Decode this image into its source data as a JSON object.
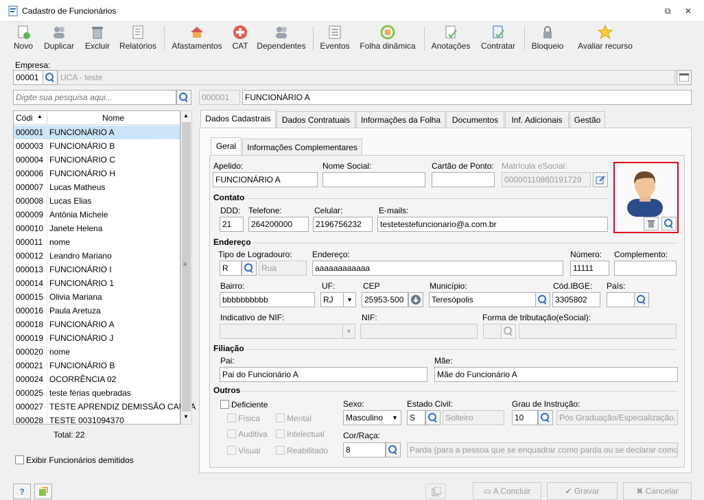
{
  "window": {
    "title": "Cadastro de Funcionários"
  },
  "toolbar": [
    {
      "label": "Novo",
      "icon": "new-doc-icon"
    },
    {
      "label": "Duplicar",
      "icon": "people-icon"
    },
    {
      "label": "Excluir",
      "icon": "trash-icon"
    },
    {
      "label": "Relatórios",
      "icon": "report-icon"
    },
    {
      "label": "Afastamentos",
      "icon": "house-icon"
    },
    {
      "label": "CAT",
      "icon": "medical-cross-icon"
    },
    {
      "label": "Dependentes",
      "icon": "people-icon"
    },
    {
      "label": "Eventos",
      "icon": "list-icon"
    },
    {
      "label": "Folha dinâmica",
      "icon": "calendar-refresh-icon"
    },
    {
      "label": "Anotações",
      "icon": "notes-icon"
    },
    {
      "label": "Contratar",
      "icon": "contract-icon"
    },
    {
      "label": "Bloqueio",
      "icon": "lock-icon"
    },
    {
      "label": "Avaliar recurso",
      "icon": "star-icon"
    }
  ],
  "company": {
    "label": "Empresa:",
    "code": "00001",
    "name": "UCA - teste"
  },
  "search": {
    "placeholder": "Digite sua pesquisa aqui..."
  },
  "selected": {
    "code": "000001",
    "name": "FUNCIONÁRIO A"
  },
  "list": {
    "headers": [
      "Códi",
      "Nome"
    ],
    "rows": [
      [
        "000001",
        "FUNCIONÁRIO A"
      ],
      [
        "000003",
        "FUNCIONÁRIO B"
      ],
      [
        "000004",
        "FUNCIONÁRIO C"
      ],
      [
        "000006",
        "FUNCIONÁRIO H"
      ],
      [
        "000007",
        "Lucas Matheus"
      ],
      [
        "000008",
        "Lucas Elias"
      ],
      [
        "000009",
        "Antônia Michele"
      ],
      [
        "000010",
        "Janete Helena"
      ],
      [
        "000011",
        "nome"
      ],
      [
        "000012",
        "Leandro Mariano"
      ],
      [
        "000013",
        "FUNCIONÁRIO I"
      ],
      [
        "000014",
        "FUNCIONÁRIO 1"
      ],
      [
        "000015",
        "Olivia Mariana"
      ],
      [
        "000016",
        "Paula Aretuza"
      ],
      [
        "000018",
        "FUNCIONÁRIO A"
      ],
      [
        "000019",
        "FUNCIONÁRIO J"
      ],
      [
        "000020",
        "nome"
      ],
      [
        "000021",
        "FUNCIONÁRIO B"
      ],
      [
        "000024",
        "OCORRÊNCIA 02"
      ],
      [
        "000025",
        "teste férias quebradas"
      ],
      [
        "000027",
        "TESTE APRENDIZ DEMISSÃO CAUSA"
      ],
      [
        "000028",
        "TESTE 0031094370"
      ]
    ],
    "total": "Total: 22"
  },
  "show_dismissed": "Exibir Funcionários demitidos",
  "tabs": [
    "Dados Cadastrais",
    "Dados Contratuais",
    "Informações da Folha",
    "Documentos",
    "Inf. Adicionais",
    "Gestão"
  ],
  "subtabs": [
    "Geral",
    "Informações Complementares"
  ],
  "form": {
    "apelido_label": "Apelido:",
    "apelido": "FUNCIONÁRIO A",
    "nome_social_label": "Nome Social:",
    "nome_social": "",
    "cartao_label": "Cartão de Ponto:",
    "cartao": "",
    "matricula_label": "Matrícula eSocial:",
    "matricula": "00000110860191729",
    "contato": "Contato",
    "ddd_label": "DDD:",
    "ddd": "21",
    "telefone_label": "Telefone:",
    "telefone": "264200000",
    "celular_label": "Celular:",
    "celular": "2196756232",
    "emails_label": "E-mails:",
    "emails": "testetestefuncionario@a.com.br",
    "endereco_sec": "Endereço",
    "tipo_label": "Tipo de Logradouro:",
    "tipo": "R",
    "tipo_desc": "Rua",
    "endereco_label": "Endereço:",
    "endereco": "aaaaaaaaaaaa",
    "numero_label": "Número:",
    "numero": "11111",
    "complemento_label": "Complemento:",
    "complemento": "",
    "bairro_label": "Bairro:",
    "bairro": "bbbbbbbbbb",
    "uf_label": "UF:",
    "uf": "RJ",
    "cep_label": "CEP",
    "cep": "25953-500",
    "municipio_label": "Município:",
    "municipio": "Teresópolis",
    "ibge_label": "Cód.IBGE:",
    "ibge": "3305802",
    "pais_label": "País:",
    "pais": "",
    "nif_ind_label": "Indicativo de NIF:",
    "nif_label": "NIF:",
    "trib_label": "Forma de tributação(eSocial):",
    "filiacao": "Filiação",
    "pai_label": "Pai:",
    "pai": "Pai do Funcionário A",
    "mae_label": "Mãe:",
    "mae": "Mãe do Funcionário A",
    "outros": "Outros",
    "deficiente": "Deficiente",
    "def_opts": [
      "Física",
      "Mental",
      "Auditiva",
      "Intelectual",
      "Visual",
      "Reabilitado"
    ],
    "sexo_label": "Sexo:",
    "sexo": "Masculino",
    "estado_label": "Estado Civil:",
    "estado": "S",
    "estado_desc": "Solteiro",
    "grau_label": "Grau de Instrução:",
    "grau": "10",
    "grau_desc": "Pós Graduação/Especialização.",
    "cor_label": "Cor/Raça:",
    "cor": "8",
    "cor_desc": "Parda (para a pessoa que se enquadrar como parda ou se declarar como m"
  },
  "footer": {
    "concluir": "A Concluir",
    "gravar": "Gravar",
    "cancelar": "Cancelar"
  },
  "colors": {
    "highlight": "#e0001b",
    "selection": "#cce4f7"
  }
}
